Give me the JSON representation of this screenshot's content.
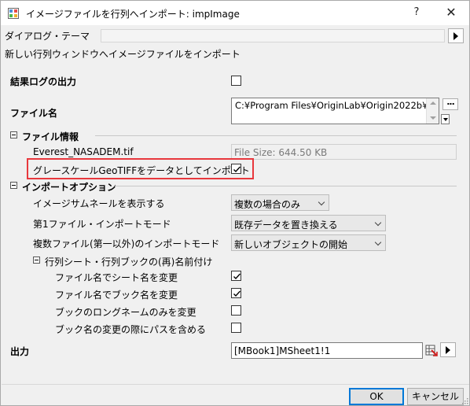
{
  "window": {
    "title": "イメージファイルを行列へインポート: impImage",
    "help_label": "?",
    "close_label": "✕"
  },
  "theme": {
    "label": "ダイアログ・テーマ",
    "value": ""
  },
  "description": "新しい行列ウィンドウへイメージファイルをインポート",
  "output_log": {
    "label": "結果ログの出力",
    "checked": false
  },
  "filename": {
    "label": "ファイル名",
    "value": "C:¥Program Files¥OriginLab¥Origin2022b¥S",
    "browse_label": "..."
  },
  "file_info": {
    "header": "ファイル情報",
    "file": "Everest_NASADEM.tif",
    "size": "File Size: 644.50 KB",
    "geotiff_label": "グレースケールGeoTIFFをデータとしてインポート",
    "geotiff_checked": true
  },
  "import_options": {
    "header": "インポートオプション",
    "thumbnail_label": "イメージサムネールを表示する",
    "thumbnail_value": "複数の場合のみ",
    "first_mode_label": "第1ファイル・インポートモード",
    "first_mode_value": "既存データを置き換える",
    "multi_mode_label": "複数ファイル(第一以外)のインポートモード",
    "multi_mode_value": "新しいオブジェクトの開始",
    "rename": {
      "header": "行列シート・行列ブックの(再)名前付け",
      "items": [
        {
          "label": "ファイル名でシート名を変更",
          "checked": true
        },
        {
          "label": "ファイル名でブック名を変更",
          "checked": true
        },
        {
          "label": "ブックのロングネームのみを変更",
          "checked": false
        },
        {
          "label": "ブック名の変更の際にパスを含める",
          "checked": false
        }
      ]
    }
  },
  "output": {
    "label": "出力",
    "value": "[MBook1]MSheet1!1"
  },
  "buttons": {
    "ok": "OK",
    "cancel": "キャンセル"
  },
  "colors": {
    "highlight_border": "#e8383d",
    "default_button_border": "#0078d7"
  }
}
